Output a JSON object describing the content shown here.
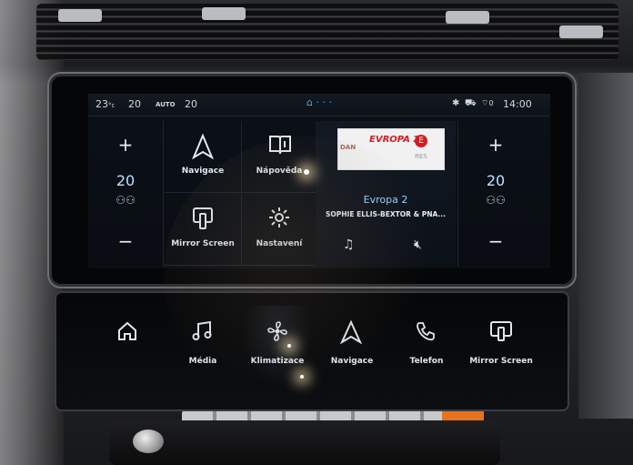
{
  "status_bar": {
    "temp_left": "23",
    "temp_left_unit": "°c",
    "driver_temp": "20",
    "auto_label": "AUTO",
    "passenger_temp": "20",
    "time": "14:00",
    "signal": "0"
  },
  "climate": {
    "left": {
      "plus": "+",
      "value": "20",
      "minus": "−"
    },
    "right": {
      "plus": "+",
      "value": "20",
      "minus": "−"
    }
  },
  "tiles": [
    {
      "label": "Navigace",
      "icon": "navigation-arrow-icon"
    },
    {
      "label": "Nápověda",
      "icon": "book-help-icon"
    },
    {
      "label": "Mirror Screen",
      "icon": "mirror-screen-icon"
    },
    {
      "label": "Nastavení",
      "icon": "gear-icon"
    }
  ],
  "radio": {
    "logo_left": "DAN",
    "logo_brand": "EVROPA 2",
    "logo_badge": "E",
    "logo_right": "RES",
    "station": "Evropa 2",
    "track": "SOPHIE ELLIS-BEXTOR & PNA..."
  },
  "lower_bar": [
    {
      "label": "",
      "icon": "home-icon"
    },
    {
      "label": "Média",
      "icon": "music-note-icon"
    },
    {
      "label": "Klimatizace",
      "icon": "fan-icon"
    },
    {
      "label": "Navigace",
      "icon": "navigation-arrow-icon"
    },
    {
      "label": "Telefon",
      "icon": "phone-icon"
    },
    {
      "label": "Mirror Screen",
      "icon": "mirror-screen-icon"
    }
  ],
  "colors": {
    "accent": "#4aa6ff",
    "brand_red": "#d21d24",
    "screen_bg": "#0b1017"
  }
}
